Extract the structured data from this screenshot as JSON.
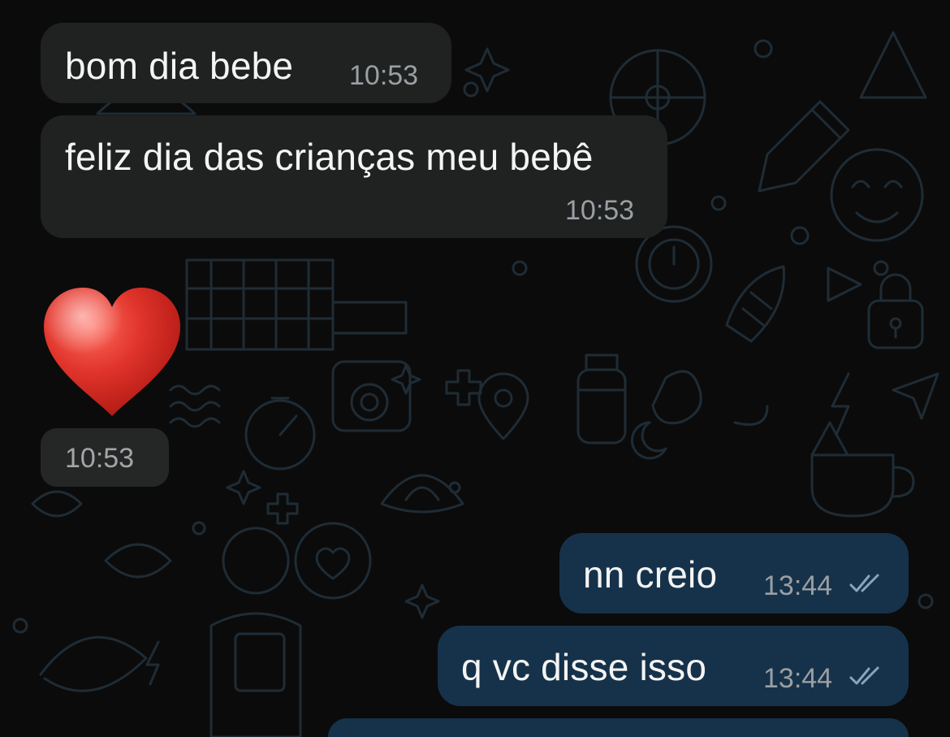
{
  "messages": [
    {
      "direction": "incoming",
      "text": "bom dia bebe",
      "time": "10:53"
    },
    {
      "direction": "incoming",
      "text": "feliz dia das crianças meu bebê",
      "time": "10:53"
    },
    {
      "direction": "incoming",
      "emoji": "heart-emoji",
      "time": "10:53"
    },
    {
      "direction": "outgoing",
      "text": "nn creio",
      "time": "13:44",
      "status": "read"
    },
    {
      "direction": "outgoing",
      "text": "q vc disse isso",
      "time": "13:44",
      "status": "read"
    },
    {
      "direction": "outgoing",
      "text": "",
      "time": "",
      "status": ""
    }
  ],
  "colors": {
    "background": "#0b0b0c",
    "incoming_bubble": "#202121",
    "outgoing_bubble": "#16324a",
    "wallpaper_stroke": "#1e2b34",
    "text": "#f4f4f4",
    "timestamp": "#9a9fa3",
    "ticks": "#8aa4b8",
    "heart": "#e0342b"
  },
  "icons": [
    "double-check-icon",
    "heart-emoji"
  ]
}
